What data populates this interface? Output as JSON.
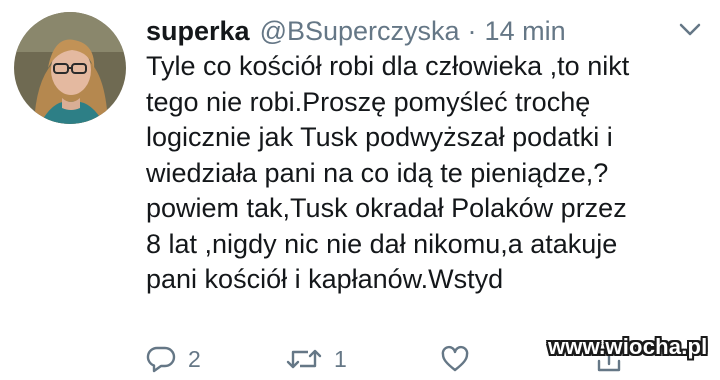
{
  "tweet": {
    "author": {
      "name": "superka",
      "handle": "@BSuperczyska",
      "separator": "·",
      "time": "14 min"
    },
    "text_lines": [
      "Tyle co kościół robi dla człowieka ,to nikt",
      "tego nie robi.Proszę pomyśleć trochę",
      "logicznie jak Tusk podwyższał podatki i",
      "wiedziała pani na co idą te pieniądze,?",
      "powiem tak,Tusk okradał Polaków przez",
      "8 lat ,nigdy nic nie dał nikomu,a atakuje",
      "pani kościół i kapłanów.Wstyd"
    ],
    "actions": {
      "reply": {
        "icon": "reply-icon",
        "count": "2"
      },
      "retweet": {
        "icon": "retweet-icon",
        "count": "1"
      },
      "like": {
        "icon": "heart-icon"
      },
      "share": {
        "icon": "share-icon"
      }
    },
    "menu_icon": "chevron-down-icon"
  },
  "watermark": "www.wiocha.pl",
  "colors": {
    "text": "#14171a",
    "secondary": "#657786",
    "background": "#ffffff"
  }
}
